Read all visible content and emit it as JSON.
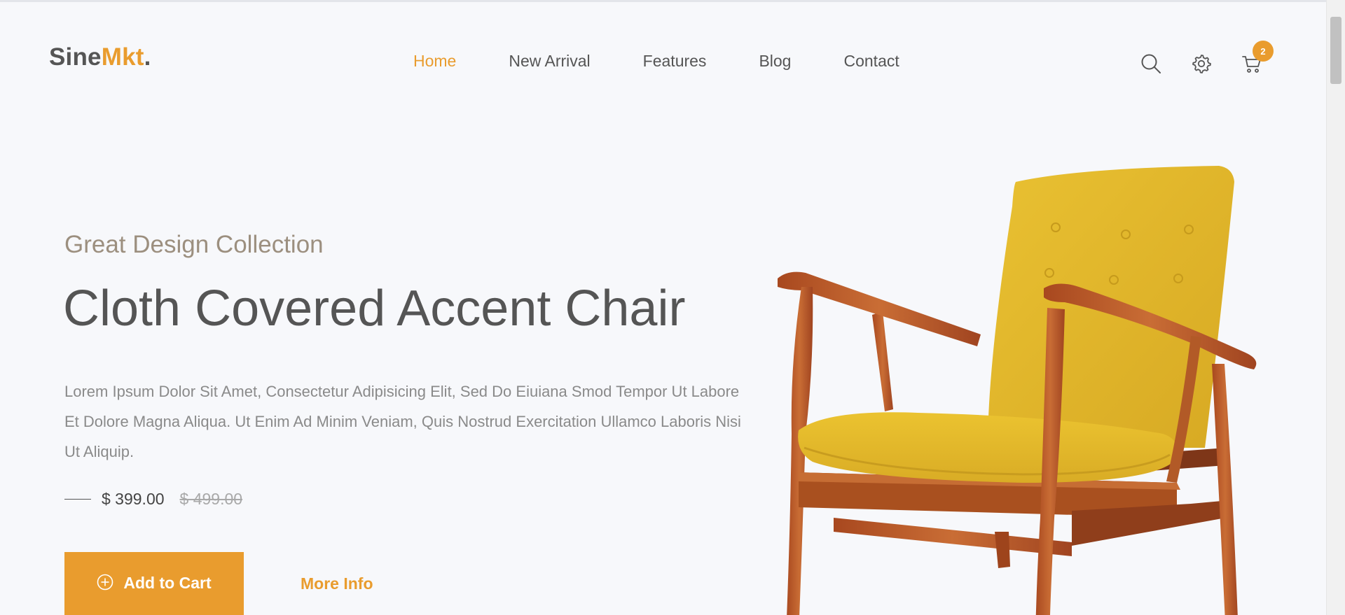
{
  "header": {
    "logo_main": "Sine",
    "logo_accent": "Mkt",
    "logo_dot": ".",
    "nav": [
      {
        "label": "Home",
        "active": true
      },
      {
        "label": "New Arrival",
        "active": false
      },
      {
        "label": "Features",
        "active": false
      },
      {
        "label": "Blog",
        "active": false
      },
      {
        "label": "Contact",
        "active": false
      }
    ],
    "icons": [
      "search-icon",
      "gear-icon",
      "cart-icon"
    ],
    "cart_count": "2"
  },
  "hero": {
    "subtitle": "Great Design Collection",
    "title": "Cloth Covered Accent Chair",
    "description": "Lorem Ipsum Dolor Sit Amet, Consectetur Adipisicing Elit, Sed Do Eiuiana Smod Tempor Ut Labore Et Dolore Magna Aliqua. Ut Enim Ad Minim Veniam, Quis Nostrud Exercitation Ullamco Laboris Nisi Ut Aliquip.",
    "price_current": "$ 399.00",
    "price_old": "$ 499.00",
    "add_to_cart_label": "Add to Cart",
    "more_info_label": "More Info"
  },
  "colors": {
    "accent": "#e99c2e",
    "text_dark": "#555555",
    "subtitle": "#9c8f7f",
    "background": "#f7f8fb",
    "chair_fabric": "#e0b42c",
    "chair_wood": "#b9582a"
  }
}
